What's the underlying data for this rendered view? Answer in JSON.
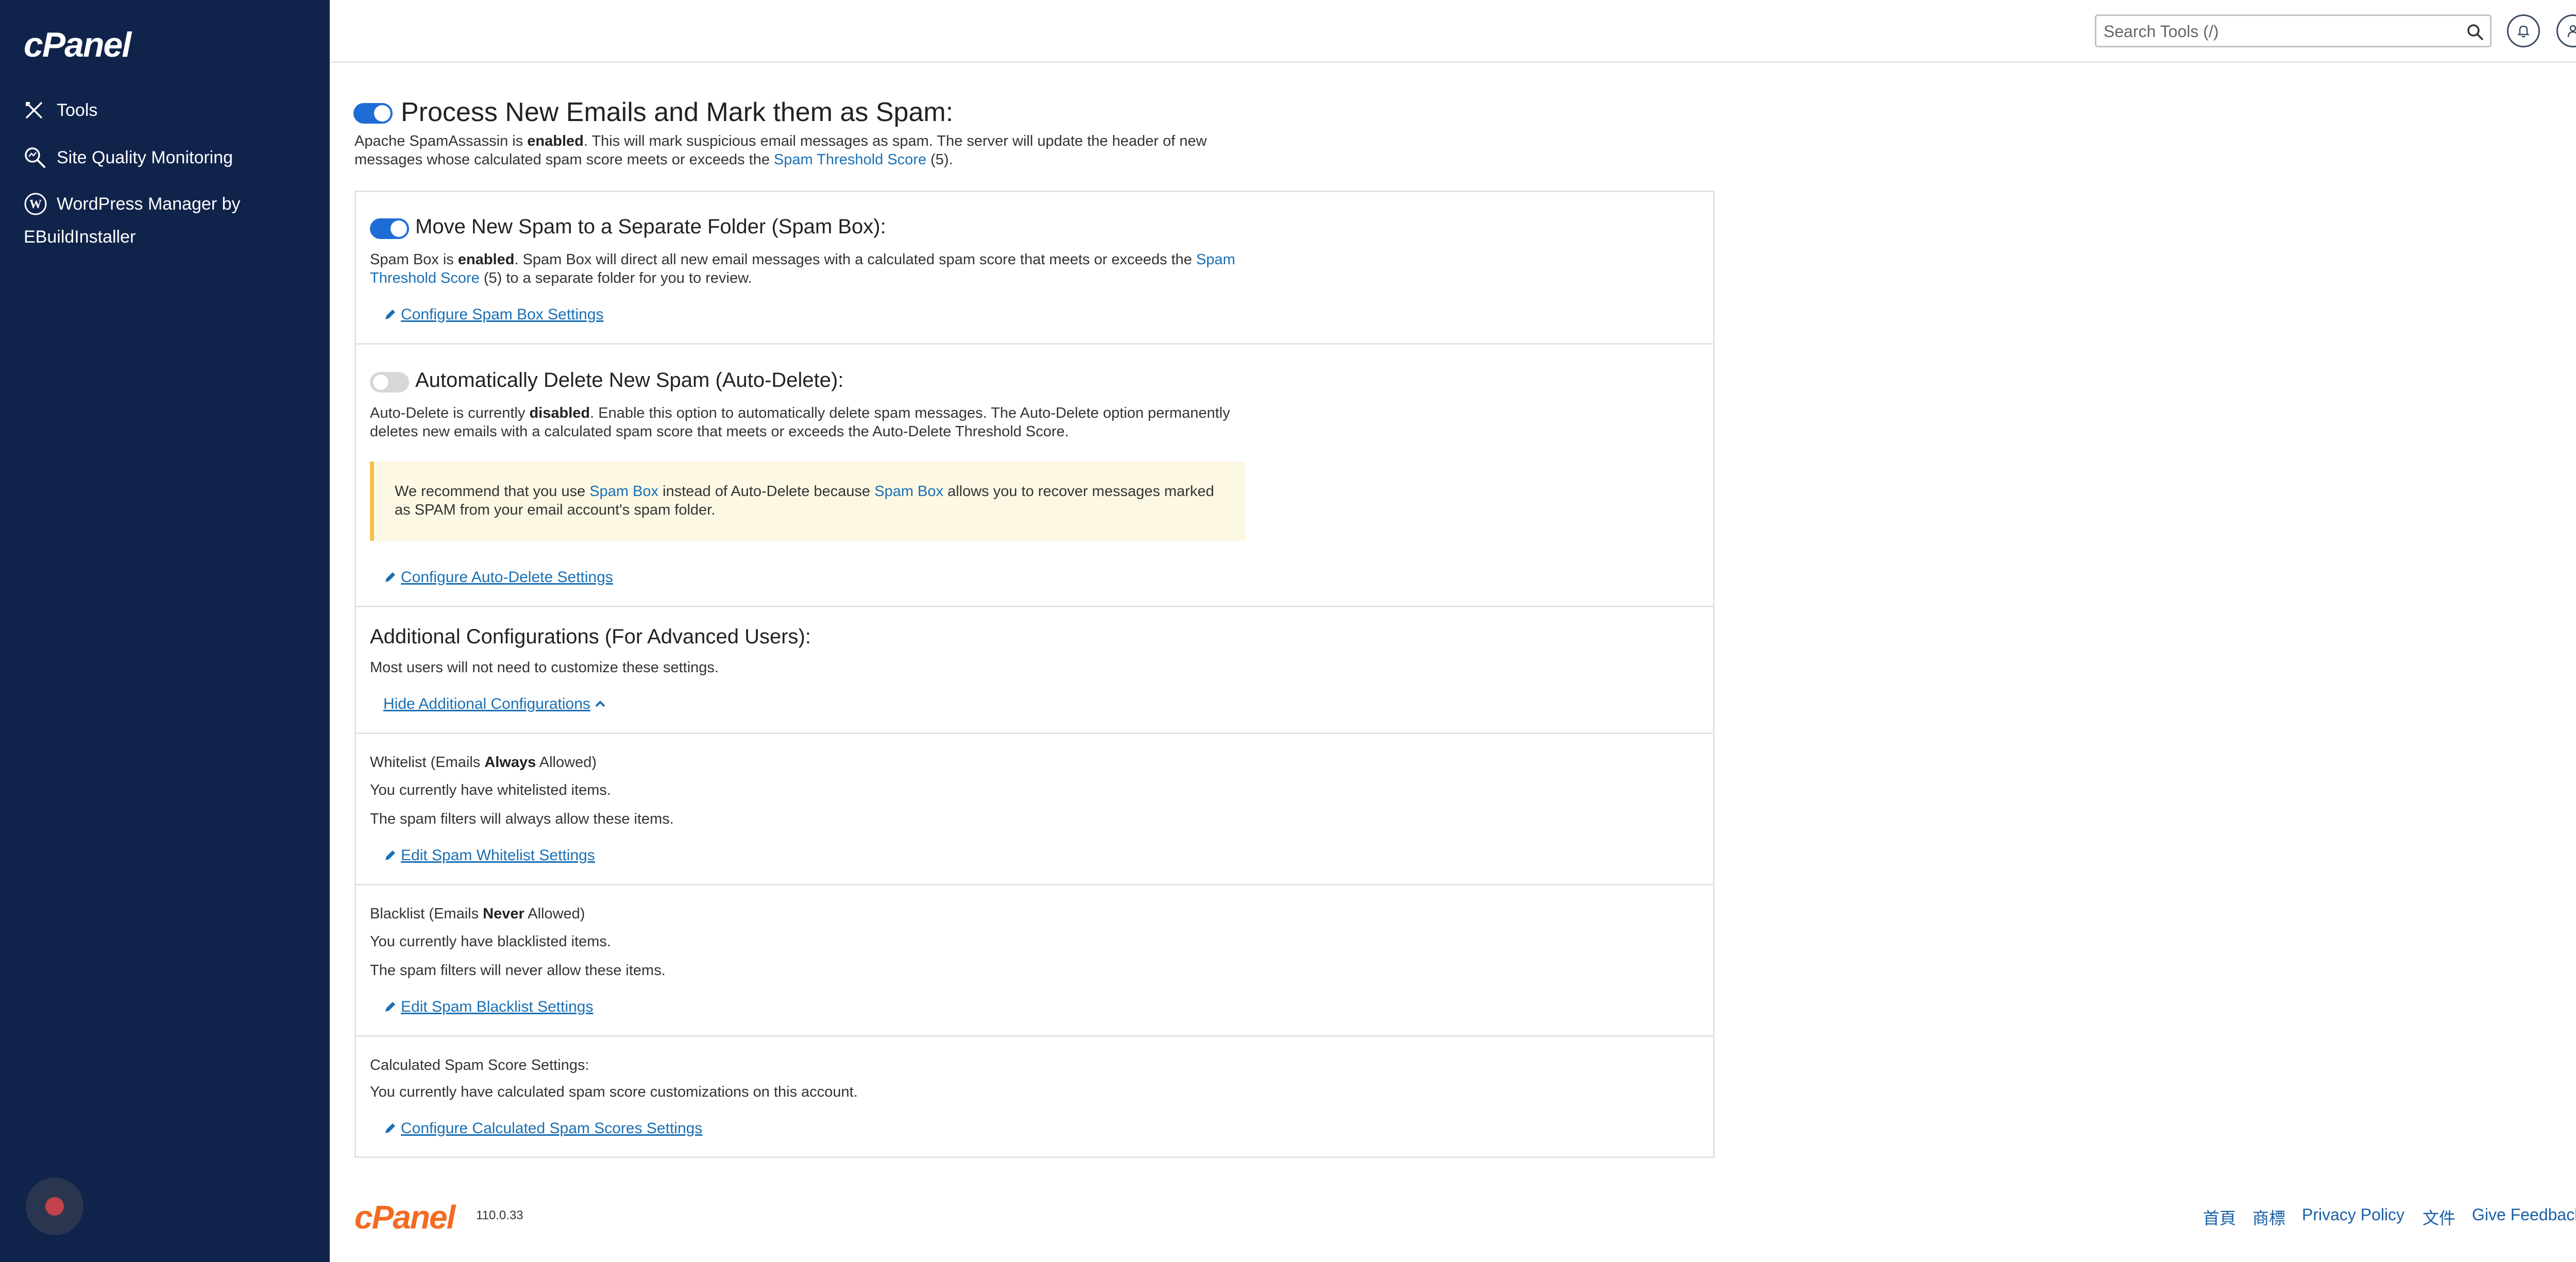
{
  "sidebar": {
    "logo": "cPanel",
    "items": [
      {
        "label": "Tools",
        "icon": "tools-icon"
      },
      {
        "label": "Site Quality Monitoring",
        "icon": "search-chart-icon"
      },
      {
        "label_line1": "WordPress Manager by",
        "label_line2": "EBuildInstaller",
        "icon": "wordpress-icon"
      }
    ]
  },
  "topbar": {
    "search_placeholder": "Search Tools (/)"
  },
  "main": {
    "process": {
      "title": "Process New Emails and Mark them as Spam:",
      "toggle_on": true,
      "desc_prefix": "Apache SpamAssassin is ",
      "desc_status": "enabled",
      "desc_mid": ". This will mark suspicious email messages as spam. The server will update the header of new messages whose calculated spam score meets or exceeds the ",
      "desc_link": "Spam Threshold Score",
      "desc_suffix": " (5)."
    },
    "spambox": {
      "title": "Move New Spam to a Separate Folder (Spam Box):",
      "toggle_on": true,
      "desc_prefix": "Spam Box is ",
      "desc_status": "enabled",
      "desc_mid": ". Spam Box will direct all new email messages with a calculated spam score that meets or exceeds the ",
      "desc_link": "Spam Threshold Score",
      "desc_suffix": " (5) to a separate folder for you to review.",
      "action": "Configure Spam Box Settings"
    },
    "autodelete": {
      "title": "Automatically Delete New Spam (Auto-Delete):",
      "toggle_on": false,
      "desc_prefix": "Auto-Delete is currently ",
      "desc_status": "disabled",
      "desc_suffix": ". Enable this option to automatically delete spam messages. The Auto-Delete option permanently deletes new emails with a calculated spam score that meets or exceeds the Auto-Delete Threshold Score.",
      "alert_prefix": "We recommend that you use ",
      "alert_link1": "Spam Box",
      "alert_mid": " instead of Auto-Delete because ",
      "alert_link2": "Spam Box",
      "alert_suffix": " allows you to recover messages marked as SPAM from your email account's spam folder.",
      "action": "Configure Auto-Delete Settings"
    },
    "additional": {
      "title": "Additional Configurations (For Advanced Users):",
      "desc": "Most users will not need to customize these settings.",
      "toggle_link": "Hide Additional Configurations"
    },
    "whitelist": {
      "title_prefix": "Whitelist (Emails ",
      "title_bold": "Always",
      "title_suffix": " Allowed)",
      "line1": "You currently have whitelisted items.",
      "line2": "The spam filters will always allow these items.",
      "action": "Edit Spam Whitelist Settings"
    },
    "blacklist": {
      "title_prefix": "Blacklist (Emails ",
      "title_bold": "Never",
      "title_suffix": " Allowed)",
      "line1": "You currently have blacklisted items.",
      "line2": "The spam filters will never allow these items.",
      "action": "Edit Spam Blacklist Settings"
    },
    "calculated": {
      "title": "Calculated Spam Score Settings:",
      "line1": "You currently have calculated spam score customizations on this account.",
      "action": "Configure Calculated Spam Scores Settings"
    }
  },
  "footer": {
    "logo": "cPanel",
    "version": "110.0.33",
    "links": [
      "首頁",
      "商標",
      "Privacy Policy",
      "文件",
      "Give Feedback"
    ]
  },
  "colors": {
    "sidebar_bg": "#10234a",
    "accent": "#1e6cd6",
    "link": "#1a6fb4",
    "brand_orange": "#f26b21",
    "alert_bg": "#fcf8e3"
  }
}
